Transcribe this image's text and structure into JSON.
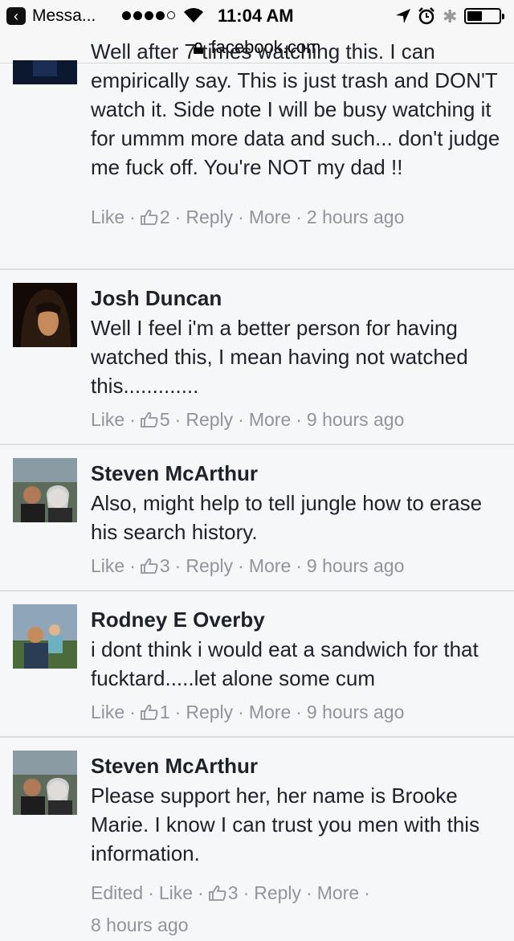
{
  "status_bar": {
    "back_label": "Messa...",
    "time": "11:04 AM"
  },
  "url_bar": {
    "domain": "facebook.com"
  },
  "colors": {
    "meta_gray": "#90949c",
    "text": "#1d2129",
    "divider": "#dddfe2"
  },
  "comments": [
    {
      "name": "",
      "text": "Well after 7 times watching this. I can empirically say. This is just trash and DON'T watch it. Side note I will be busy watching it for ummm more data and such... don't judge me fuck off. You're NOT my dad !!",
      "like": "Like",
      "likes": "2",
      "reply": "Reply",
      "more": "More",
      "time": "2 hours ago"
    },
    {
      "name": "Josh Duncan",
      "text": "Well I feel i'm a better person for having watched this, I mean having not watched this.............",
      "like": "Like",
      "likes": "5",
      "reply": "Reply",
      "more": "More",
      "time": "9 hours ago"
    },
    {
      "name": "Steven McArthur",
      "text": "Also, might help to tell jungle how to erase his search history.",
      "like": "Like",
      "likes": "3",
      "reply": "Reply",
      "more": "More",
      "time": "9 hours ago"
    },
    {
      "name": "Rodney E Overby",
      "text": "i dont think i would eat a sandwich for that fucktard.....let alone some cum",
      "like": "Like",
      "likes": "1",
      "reply": "Reply",
      "more": "More",
      "time": "9 hours ago"
    },
    {
      "name": "Steven McArthur",
      "text": "Please support her, her name is Brooke Marie. I know I can trust you men with this information.",
      "edited": "Edited",
      "like": "Like",
      "likes": "3",
      "reply": "Reply",
      "more": "More",
      "time": "8 hours ago"
    }
  ]
}
